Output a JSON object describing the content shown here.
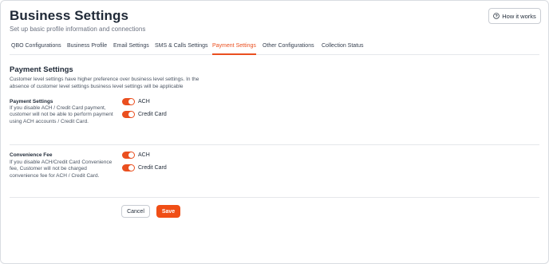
{
  "header": {
    "title": "Business Settings",
    "subtitle": "Set up basic profile information and connections",
    "how_it_works": "How it works"
  },
  "tabs": [
    {
      "label": "QBO Configurations"
    },
    {
      "label": "Business Profile"
    },
    {
      "label": "Email Settings"
    },
    {
      "label": "SMS & Calls Settings"
    },
    {
      "label": "Payment Settings"
    },
    {
      "label": "Other Configurations"
    },
    {
      "label": "Collection Status"
    }
  ],
  "active_tab": "Payment Settings",
  "section": {
    "title": "Payment Settings",
    "description": "Customer level settings have higher preference over business level settings. In the absence of customer level settings business level settings will be applicable"
  },
  "groups": [
    {
      "label": "Payment Settings",
      "description": "If you disable ACH / Credit Card payment, customer will not be able to perform payment using ACH accounts / Credit Card.",
      "toggles": [
        {
          "label": "ACH",
          "on": true
        },
        {
          "label": "Credit Card",
          "on": true
        }
      ]
    },
    {
      "label": "Convenience Fee",
      "description": "If you disable ACH/Credit Card Convenience fee, Customer will not be charged convenience fee for ACH / Credit Card.",
      "toggles": [
        {
          "label": "ACH",
          "on": true
        },
        {
          "label": "Credit Card",
          "on": true
        }
      ]
    }
  ],
  "actions": {
    "cancel": "Cancel",
    "save": "Save"
  },
  "colors": {
    "accent": "#ea4f1f",
    "save_button": "#f04e16"
  },
  "icons": {
    "how_it_works": "question-circle-icon"
  }
}
